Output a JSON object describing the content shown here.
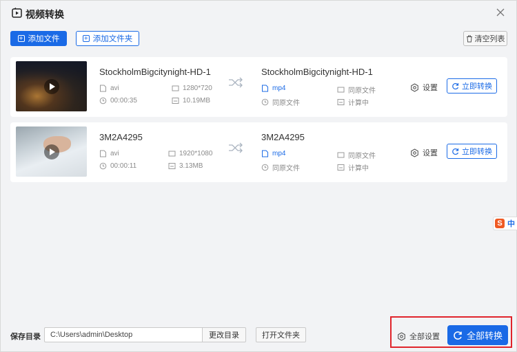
{
  "app": {
    "title": "视频转换"
  },
  "toolbar": {
    "add_file": "添加文件",
    "add_folder": "添加文件夹",
    "clear_list": "清空列表"
  },
  "files": [
    {
      "source_name": "StockholmBigcitynight-HD-1",
      "source_format": "avi",
      "source_resolution": "1280*720",
      "source_duration": "00:00:35",
      "source_size": "10.19MB",
      "target_name": "StockholmBigcitynight-HD-1",
      "target_format": "mp4",
      "target_resolution": "同原文件",
      "target_duration": "同原文件",
      "target_size": "计算中",
      "settings_label": "设置",
      "convert_label": "立即转换"
    },
    {
      "source_name": "3M2A4295",
      "source_format": "avi",
      "source_resolution": "1920*1080",
      "source_duration": "00:00:11",
      "source_size": "3.13MB",
      "target_name": "3M2A4295",
      "target_format": "mp4",
      "target_resolution": "同原文件",
      "target_duration": "同原文件",
      "target_size": "计算中",
      "settings_label": "设置",
      "convert_label": "立即转换"
    }
  ],
  "ime": {
    "logo": "S",
    "label": "中"
  },
  "footer": {
    "save_dir_label": "保存目录",
    "save_path": "C:\\Users\\admin\\Desktop",
    "change_dir": "更改目录",
    "open_folder": "打开文件夹",
    "all_settings": "全部设置",
    "convert_all": "全部转换"
  },
  "colors": {
    "accent": "#1a6ae6",
    "highlight": "#e0232a",
    "background": "#f2f3f5"
  }
}
